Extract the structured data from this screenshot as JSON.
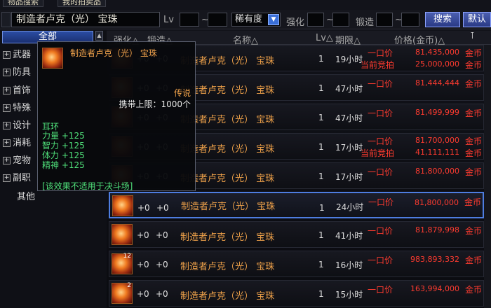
{
  "tabs": [
    "物品搜索",
    "我的拍卖品"
  ],
  "search": {
    "value": "制造者卢克（光） 宝珠",
    "lv_label": "Lv",
    "tilde": "~",
    "rarity": "稀有度",
    "rarity_arrow": "▼",
    "enhance_label": "强化",
    "amplify_label": "锻造",
    "search_btn": "搜索",
    "default_btn": "默认"
  },
  "sidebar": {
    "all": "全部",
    "scroll_arrow": "▲",
    "items": [
      "武器",
      "防具",
      "首饰",
      "特殊",
      "设计",
      "消耗",
      "宠物",
      "副职"
    ],
    "other": "其他"
  },
  "header": {
    "enhance": "强化△",
    "forge": "锻造△",
    "name": "名称△",
    "lv": "Lv△",
    "period": "期限△",
    "price": "价格(金币)△",
    "corner_icon": "pin-icon"
  },
  "rows": [
    {
      "enh": "+0",
      "forge": "+0",
      "name": "制造者卢克（光） 宝珠",
      "lv": "1",
      "period": "19小时",
      "buyout_label": "一口价",
      "buyout": "81,435,000",
      "cur": "金币",
      "bid_label": "当前竞拍",
      "bid": "25,000,000",
      "bid_cur": "金币"
    },
    {
      "enh": "+0",
      "forge": "+0",
      "name": "制造者卢克（光） 宝珠",
      "lv": "1",
      "period": "47小时",
      "buyout_label": "一口价",
      "buyout": "81,444,444",
      "cur": "金币"
    },
    {
      "enh": "+0",
      "forge": "+0",
      "name": "制造者卢克（光） 宝珠",
      "lv": "1",
      "period": "47小时",
      "buyout_label": "一口价",
      "buyout": "81,499,999",
      "cur": "金币"
    },
    {
      "enh": "+0",
      "forge": "+0",
      "name": "制造者卢克（光） 宝珠",
      "lv": "1",
      "period": "17小时",
      "buyout_label": "一口价",
      "buyout": "81,700,000",
      "cur": "金币",
      "bid_label": "当前竞拍",
      "bid": "41,111,111",
      "bid_cur": "金币"
    },
    {
      "enh": "+0",
      "forge": "+0",
      "name": "制造者卢克（光） 宝珠",
      "lv": "1",
      "period": "17小时",
      "buyout_label": "一口价",
      "buyout": "81,800,000",
      "cur": "金币"
    },
    {
      "enh": "+0",
      "forge": "+0",
      "name": "制造者卢克（光） 宝珠",
      "lv": "1",
      "period": "24小时",
      "buyout_label": "一口价",
      "buyout": "81,800,000",
      "cur": "金币"
    },
    {
      "enh": "+0",
      "forge": "+0",
      "name": "制造者卢克（光） 宝珠",
      "lv": "1",
      "period": "41小时",
      "buyout_label": "一口价",
      "buyout": "81,879,998",
      "cur": "金币"
    },
    {
      "enh": "+0",
      "forge": "+0",
      "name": "制造者卢克（光） 宝珠",
      "lv": "1",
      "period": "16小时",
      "buyout_label": "一口价",
      "buyout": "983,893,332",
      "cur": "金币",
      "qty": "12"
    },
    {
      "enh": "+0",
      "forge": "+0",
      "name": "制造者卢克（光） 宝珠",
      "lv": "1",
      "period": "15小时",
      "buyout_label": "一口价",
      "buyout": "163,994,000",
      "cur": "金币",
      "qty": "2"
    }
  ],
  "tooltip": {
    "title": "制造者卢克（光） 宝珠",
    "rarity": "传说",
    "limit": "携带上限：1000个",
    "type": "耳环",
    "stats": [
      "力量 +125",
      "智力 +125",
      "体力 +125",
      "精神 +125"
    ],
    "note": "[该效果不适用于决斗场]"
  },
  "colors": {
    "accent": "#3a6fd8",
    "price": "#ff3b2f",
    "name": "#f0a24a",
    "stat": "#4fe07a"
  }
}
